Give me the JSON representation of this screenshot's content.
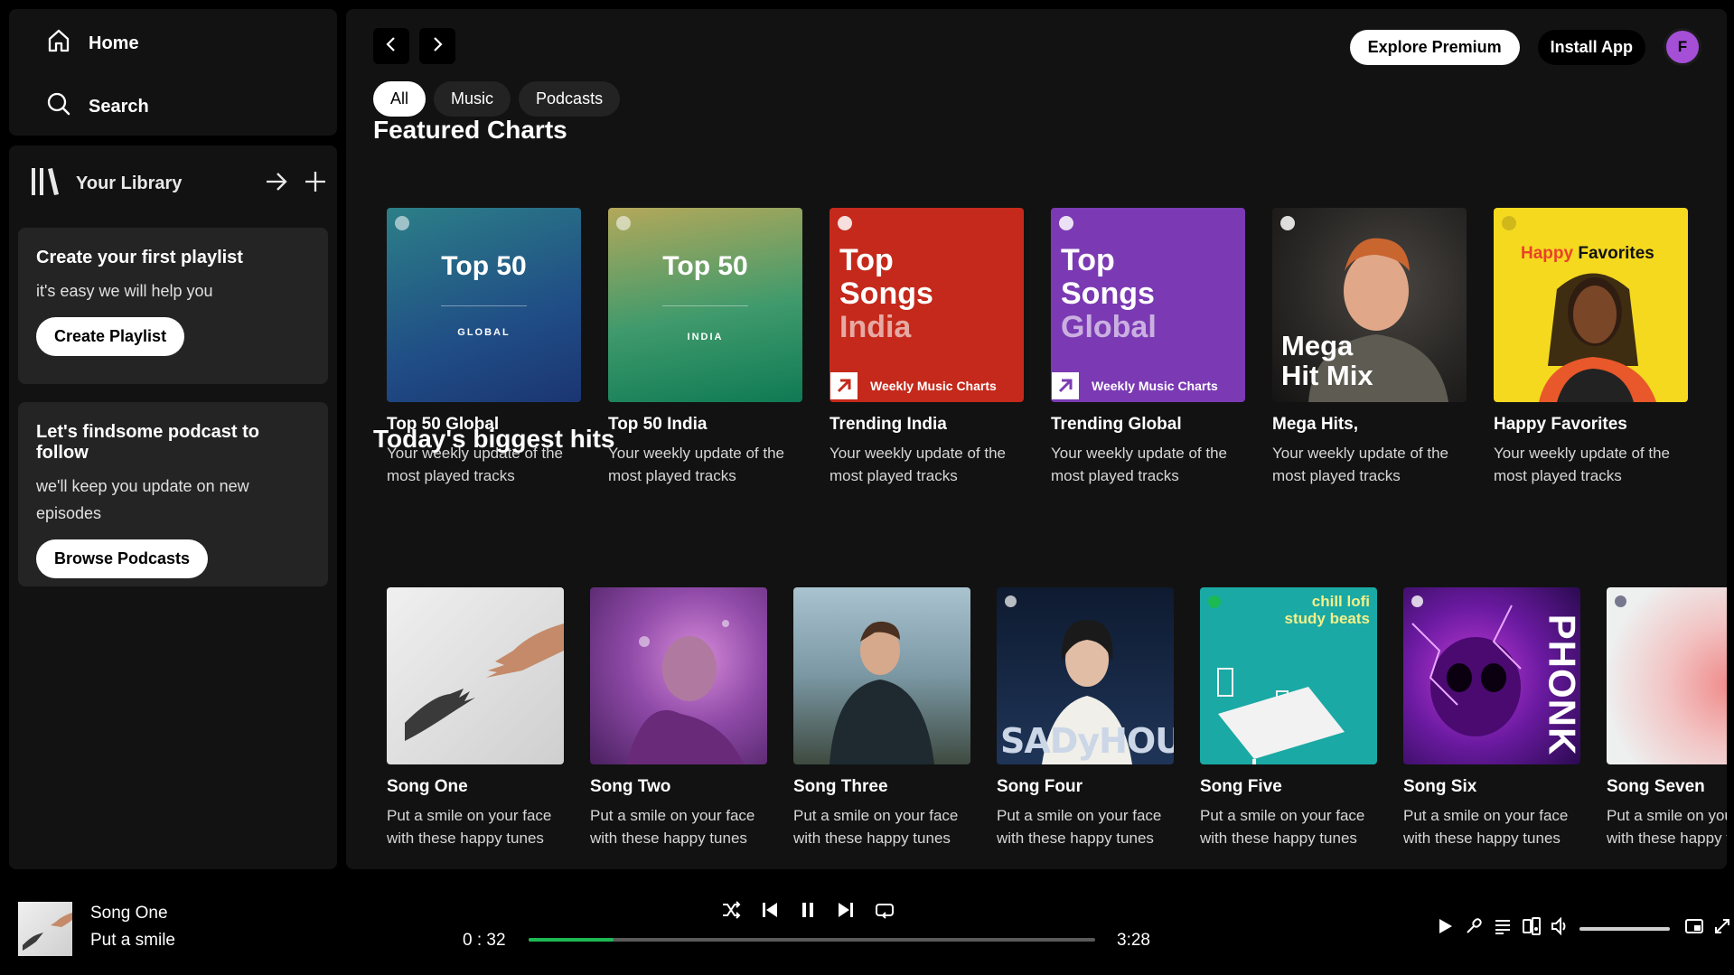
{
  "nav": {
    "home": "Home",
    "search": "Search"
  },
  "library": {
    "title": "Your Library",
    "playlist_card": {
      "title": "Create your first playlist",
      "text": "it's easy we will help you",
      "button": "Create Playlist"
    },
    "podcast_card": {
      "title": "Let's findsome podcast to follow",
      "text": "we'll keep you update on new episodes",
      "button": "Browse Podcasts"
    }
  },
  "header": {
    "explore": "Explore Premium",
    "install": "Install App",
    "avatar": "F"
  },
  "chips": [
    "All",
    "Music",
    "Podcasts"
  ],
  "featured": {
    "title": "Featured Charts",
    "cards": [
      {
        "title": "Top 50 Global",
        "desc": "Your weekly update of the most played tracks",
        "art_big": "Top 50",
        "art_sub": "GLOBAL"
      },
      {
        "title": "Top 50 India",
        "desc": "Your weekly update of the most played tracks",
        "art_big": "Top 50",
        "art_sub": "INDIA"
      },
      {
        "title": "Trending India",
        "desc": "Your weekly update of the most played tracks",
        "art_l1": "Top",
        "art_l2": "Songs",
        "art_l3": "India",
        "art_badge": "Weekly Music Charts"
      },
      {
        "title": "Trending Global",
        "desc": "Your weekly update of the most played tracks",
        "art_l1": "Top",
        "art_l2": "Songs",
        "art_l3": "Global",
        "art_badge": "Weekly Music Charts"
      },
      {
        "title": "Mega Hits,",
        "desc": "Your weekly update of the most played tracks",
        "art_l1": "Mega",
        "art_l2": "Hit Mix"
      },
      {
        "title": "Happy Favorites",
        "desc": "Your weekly update of the most played tracks",
        "art_w1": "Happy",
        "art_w2": "Favorites"
      }
    ]
  },
  "hits": {
    "title": "Today's biggest hits",
    "cards": [
      {
        "title": "Song One",
        "line1": "Put a smile on your face",
        "line2": "with these happy tunes"
      },
      {
        "title": "Song Two",
        "line1": "Put a smile on your face",
        "line2": "with these happy tunes"
      },
      {
        "title": "Song Three",
        "line1": "Put a smile on your face",
        "line2": "with these happy tunes"
      },
      {
        "title": "Song Four",
        "line1": "Put a smile on your face",
        "line2": "with these happy tunes",
        "art_text": "SADyHOUR"
      },
      {
        "title": "Song Five",
        "line1": "Put a smile on your face",
        "line2": "with these happy tunes",
        "art_l1": "chill lofi",
        "art_l2": "study beats"
      },
      {
        "title": "Song Six",
        "line1": "Put a smile on your face",
        "line2": "with these happy tunes",
        "art_text": "PHONK"
      },
      {
        "title": "Song Seven",
        "line1": "Put a smile on your face",
        "line2": "with these happy tunes"
      }
    ]
  },
  "player": {
    "title": "Song One",
    "subtitle": "Put a smile",
    "elapsed": "0 : 32",
    "duration": "3:28",
    "progress_percent": 15
  },
  "colors": {
    "accent": "#1db954",
    "avatar": "#a54ed6"
  }
}
